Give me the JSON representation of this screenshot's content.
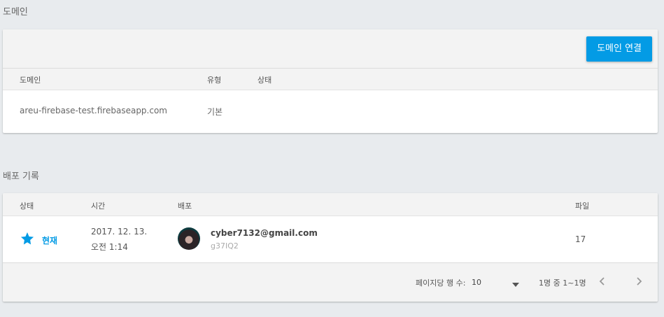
{
  "domains": {
    "title": "도메인",
    "connect_button": "도메인 연결",
    "columns": [
      "도메인",
      "유형",
      "상태"
    ],
    "rows": [
      {
        "domain": "areu-firebase-test.firebaseapp.com",
        "type": "기본",
        "status": ""
      }
    ]
  },
  "deploys": {
    "title": "배포 기록",
    "columns": [
      "상태",
      "시간",
      "배포",
      "파일"
    ],
    "rows": [
      {
        "status": "현재",
        "time_line1": "2017. 12. 13.",
        "time_line2": "오전 1:14",
        "email": "cyber7132@gmail.com",
        "hash": "g37IQ2",
        "files": "17"
      }
    ],
    "pagination": {
      "rows_per_page_label": "페이지당 행 수:",
      "rows_per_page_value": "10",
      "range_text": "1명 중 1~1명"
    }
  },
  "colors": {
    "accent": "#039be5",
    "background": "#e8ebee"
  },
  "icons": {
    "status_current": "star-icon",
    "dropdown": "arrow-drop-down-icon",
    "prev": "chevron-left-icon",
    "next": "chevron-right-icon"
  }
}
